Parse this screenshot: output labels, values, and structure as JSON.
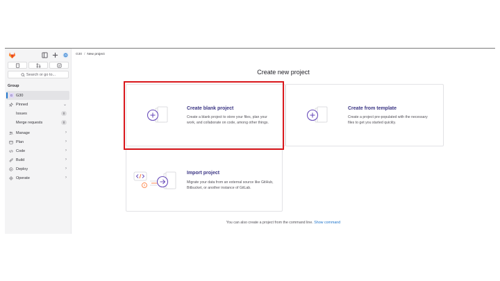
{
  "colors": {
    "accent": "#1f75cb",
    "brand": "#fc6d26",
    "highlight": "#d9161b",
    "card_title": "#3a3483",
    "illus": "#6b4fbb"
  },
  "sidebar": {
    "top_icons": [
      "gitlab-logo-icon",
      "panel-toggle-icon",
      "plus-icon",
      "avatar-icon"
    ],
    "quick_buttons": [
      "todo-icon",
      "merge-request-icon",
      "issues-icon"
    ],
    "search_placeholder": "Search or go to...",
    "section_label": "Group",
    "items": [
      {
        "label": "G30",
        "avatar": "G",
        "active": true
      },
      {
        "label": "Pinned",
        "icon": "pin-icon",
        "chevron": "⌄"
      },
      {
        "label": "Issues",
        "badge": "0",
        "sub": true
      },
      {
        "label": "Merge requests",
        "badge": "0",
        "sub": true
      },
      {
        "label": "Manage",
        "icon": "users-icon",
        "chevron": "›"
      },
      {
        "label": "Plan",
        "icon": "calendar-icon",
        "chevron": "›"
      },
      {
        "label": "Code",
        "icon": "code-icon",
        "chevron": "›"
      },
      {
        "label": "Build",
        "icon": "rocket-icon",
        "chevron": "›"
      },
      {
        "label": "Deploy",
        "icon": "deploy-icon",
        "chevron": "›"
      },
      {
        "label": "Operate",
        "icon": "operate-icon",
        "chevron": "›"
      }
    ]
  },
  "breadcrumb": {
    "group": "G30",
    "separator": "/",
    "current": "New project"
  },
  "page_title": "Create new project",
  "cards": {
    "blank": {
      "title": "Create blank project",
      "desc_1": "Create a blank project to store your files, plan your",
      "desc_2": "work, and collaborate on code, among other things."
    },
    "template": {
      "title": "Create from template",
      "desc_1": "Create a project pre-populated with the necessary",
      "desc_2": "files to get you started quickly."
    },
    "import": {
      "title": "Import project",
      "desc_1": "Migrate your data from an external source like GitHub,",
      "desc_2": "Bitbucket, or another instance of GitLab."
    }
  },
  "footer": {
    "text": "You can also create a project from the command line.",
    "link": "Show command"
  }
}
